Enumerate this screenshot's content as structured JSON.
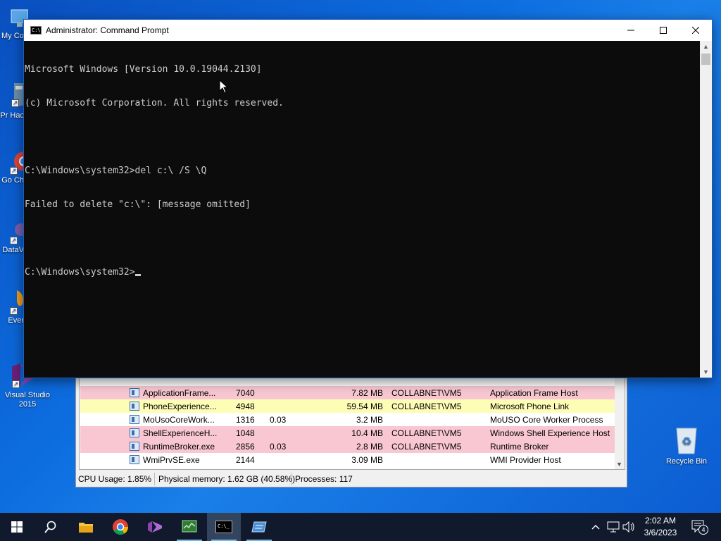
{
  "desktop": {
    "icons": [
      {
        "label": "My Co",
        "name": "desktop-icon-my-computer"
      },
      {
        "label": "Pr Hac",
        "name": "desktop-icon-pr-hac"
      },
      {
        "label": "Go Ch",
        "name": "desktop-icon-google-chrome"
      },
      {
        "label": "DataV",
        "name": "desktop-icon-datav"
      },
      {
        "label": "Ever",
        "name": "desktop-icon-ever"
      },
      {
        "label": "Visual Studio 2015",
        "name": "desktop-icon-visual-studio-2015"
      },
      {
        "label": "Recycle Bin",
        "name": "desktop-icon-recycle-bin"
      }
    ]
  },
  "cmd_window": {
    "title": "Administrator:  Command Prompt",
    "lines": [
      "Microsoft Windows [Version 10.0.19044.2130]",
      "(c) Microsoft Corporation. All rights reserved.",
      "",
      "C:\\Windows\\system32>del c:\\ /S \\Q",
      "Failed to delete \"c:\\\": [message omitted]",
      "",
      "C:\\Windows\\system32>"
    ],
    "minimize_icon": "minimize-icon",
    "maximize_icon": "maximize-icon",
    "close_icon": "close-icon"
  },
  "task_manager": {
    "processes": [
      {
        "name": "ApplicationFrame...",
        "pid": "7040",
        "cpu": "",
        "memory": "7.82 MB",
        "user": "COLLABNET\\VM5",
        "description": "Application Frame Host",
        "highlight": "pink"
      },
      {
        "name": "PhoneExperience...",
        "pid": "4948",
        "cpu": "",
        "memory": "59.54 MB",
        "user": "COLLABNET\\VM5",
        "description": "Microsoft Phone Link",
        "highlight": "yellow"
      },
      {
        "name": "MoUsoCoreWork...",
        "pid": "1316",
        "cpu": "0.03",
        "memory": "3.2 MB",
        "user": "",
        "description": "MoUSO Core Worker Process",
        "highlight": "none"
      },
      {
        "name": "ShellExperienceH...",
        "pid": "1048",
        "cpu": "",
        "memory": "10.4 MB",
        "user": "COLLABNET\\VM5",
        "description": "Windows Shell Experience Host",
        "highlight": "pink"
      },
      {
        "name": "RuntimeBroker.exe",
        "pid": "2856",
        "cpu": "0.03",
        "memory": "2.8 MB",
        "user": "COLLABNET\\VM5",
        "description": "Runtime Broker",
        "highlight": "pink"
      },
      {
        "name": "WmiPrvSE.exe",
        "pid": "2144",
        "cpu": "",
        "memory": "3.09 MB",
        "user": "",
        "description": "WMI Provider Host",
        "highlight": "none"
      }
    ],
    "status": {
      "cpu": "CPU Usage: 1.85%",
      "memory": "Physical memory: 1.62 GB (40.58%)",
      "processes": "Processes: 117"
    }
  },
  "taskbar": {
    "items": [
      {
        "name": "start-button",
        "icon": "windows-logo-icon"
      },
      {
        "name": "search-button",
        "icon": "search-icon"
      },
      {
        "name": "taskbar-file-explorer",
        "icon": "folder-icon"
      },
      {
        "name": "taskbar-chrome",
        "icon": "chrome-icon"
      },
      {
        "name": "taskbar-visual-studio",
        "icon": "visual-studio-icon"
      },
      {
        "name": "taskbar-task-manager",
        "icon": "task-manager-icon"
      },
      {
        "name": "taskbar-command-prompt",
        "icon": "cmd-icon"
      },
      {
        "name": "taskbar-app",
        "icon": "app-icon"
      }
    ],
    "clock_time": "2:02 AM",
    "clock_date": "3/6/2023",
    "notification_count": "4"
  }
}
